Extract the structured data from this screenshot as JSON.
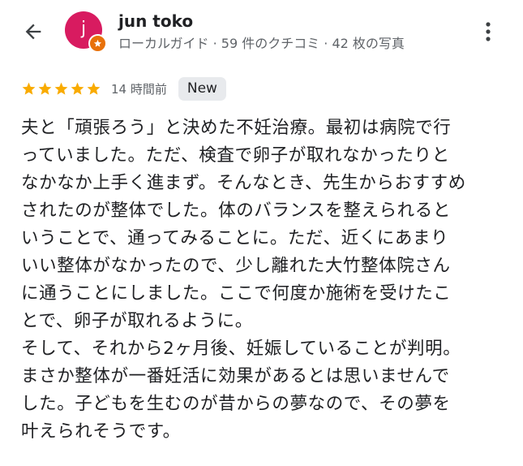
{
  "reviewer": {
    "name": "jun toko",
    "avatar_letter": "j",
    "meta": "ローカルガイド · 59 件のクチコミ · 42 枚の写真"
  },
  "review": {
    "rating": 5,
    "time_ago": "14 時間前",
    "badge": "New",
    "lines": [
      "夫と「頑張ろう」と決めた不妊治療。最初は病院で行",
      "っていました。ただ、検査で卵子が取れなかったりと",
      "なかなか上手く進まず。そんなとき、先生からおすすめ",
      "されたのが整体でした。体のバランスを整えられると",
      "いうことで、通ってみることに。ただ、近くにあまり",
      "いい整体がなかったので、少し離れた大竹整体院さん",
      "に通うことにしました。ここで何度か施術を受けたこ",
      "とで、卵子が取れるように。",
      "そして、それから2ヶ月後、妊娠していることが判明。",
      "まさか整体が一番妊活に効果があるとは思いませんで",
      "した。子どもを生むのが昔からの夢なので、その夢を",
      "叶えられそうです。"
    ]
  },
  "icons": {
    "back": "arrow-back-icon",
    "more": "more-vert-icon",
    "star": "star-icon",
    "guide_badge": "local-guide-star-icon"
  },
  "colors": {
    "avatar": "#d81b60",
    "guide_badge": "#e8710a",
    "star": "#f9ab00",
    "secondary_text": "#5f6368",
    "new_badge_bg": "#e8eaed"
  }
}
